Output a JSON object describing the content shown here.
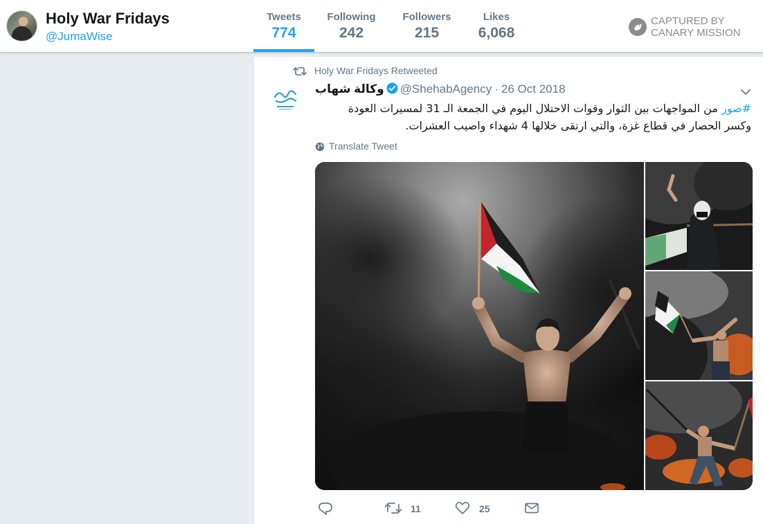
{
  "profile": {
    "name": "Holy War Fridays",
    "handle": "@JumaWise"
  },
  "stats": [
    {
      "label": "Tweets",
      "value": "774",
      "active": true
    },
    {
      "label": "Following",
      "value": "242",
      "active": false
    },
    {
      "label": "Followers",
      "value": "215",
      "active": false
    },
    {
      "label": "Likes",
      "value": "6,068",
      "active": false
    }
  ],
  "watermark": {
    "line1": "CAPTURED BY",
    "line2": "CANARY MISSION"
  },
  "tweet": {
    "retweet_context": "Holy War Fridays Retweeted",
    "author_name": "وكالة شهاب",
    "author_handle": "@ShehabAgency",
    "separator": "·",
    "date": "26 Oct 2018",
    "hashtag": "#صور",
    "text_line1": " من المواجهات بين الثوار وقوات الاحتلال اليوم في الجمعة الـ 31 لمسيرات العودة",
    "text_line2": "وكسر الحصار في قطاع غزة، والتي ارتقى خلالها 4 شهداء واصيب العشرات.",
    "translate_label": "Translate Tweet",
    "reply_count": "",
    "retweet_count": "11",
    "like_count": "25"
  },
  "colors": {
    "accent": "#1da1f2",
    "muted": "#657786",
    "background": "#e6ecf0"
  },
  "icons": {
    "retweet_context": "retweet-icon",
    "verified": "verified-badge-icon",
    "caret": "chevron-down-icon",
    "translate": "globe-icon",
    "reply": "reply-icon",
    "retweet": "retweet-icon",
    "like": "heart-icon",
    "dm": "envelope-icon"
  }
}
